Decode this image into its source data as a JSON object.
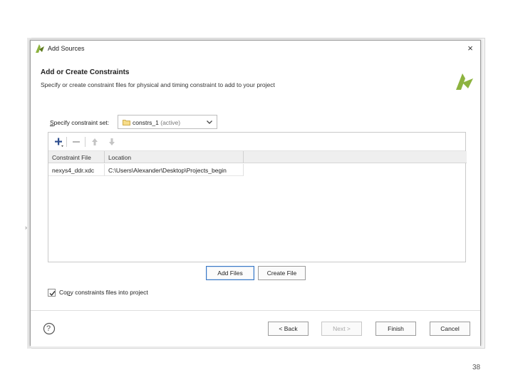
{
  "window": {
    "title": "Add Sources",
    "close_glyph": "×"
  },
  "header": {
    "heading": "Add or Create Constraints",
    "subheading": "Specify or create constraint files for physical and timing constraint to add to your project"
  },
  "constraint_set": {
    "label_prefix": "S",
    "label_rest": "pecify constraint set:",
    "selected_name": "constrs_1",
    "selected_suffix": "(active)"
  },
  "toolbar": {
    "icons": [
      "plus-icon",
      "minus-icon",
      "arrow-up-icon",
      "arrow-down-icon"
    ]
  },
  "table": {
    "columns": [
      "Constraint File",
      "Location"
    ],
    "rows": [
      {
        "file": "nexys4_ddr.xdc",
        "location": "C:\\Users\\Alexander\\Desktop\\Projects_begin"
      }
    ]
  },
  "buttons": {
    "add_files": "Add Files",
    "create_file": "Create File",
    "back": "< Back",
    "next": "Next >",
    "finish": "Finish",
    "cancel": "Cancel"
  },
  "options": {
    "copy_prefix": "Co",
    "copy_underline": "p",
    "copy_rest": "y constraints files into project",
    "copy_checked": true
  },
  "help": {
    "glyph": "?"
  },
  "slide": {
    "page_number": "38"
  },
  "colors": {
    "logo_green": "#8db33f",
    "logo_dark": "#5d7a1f",
    "focus_blue": "#3b78c4",
    "folder_yellow": "#e3b94c"
  }
}
